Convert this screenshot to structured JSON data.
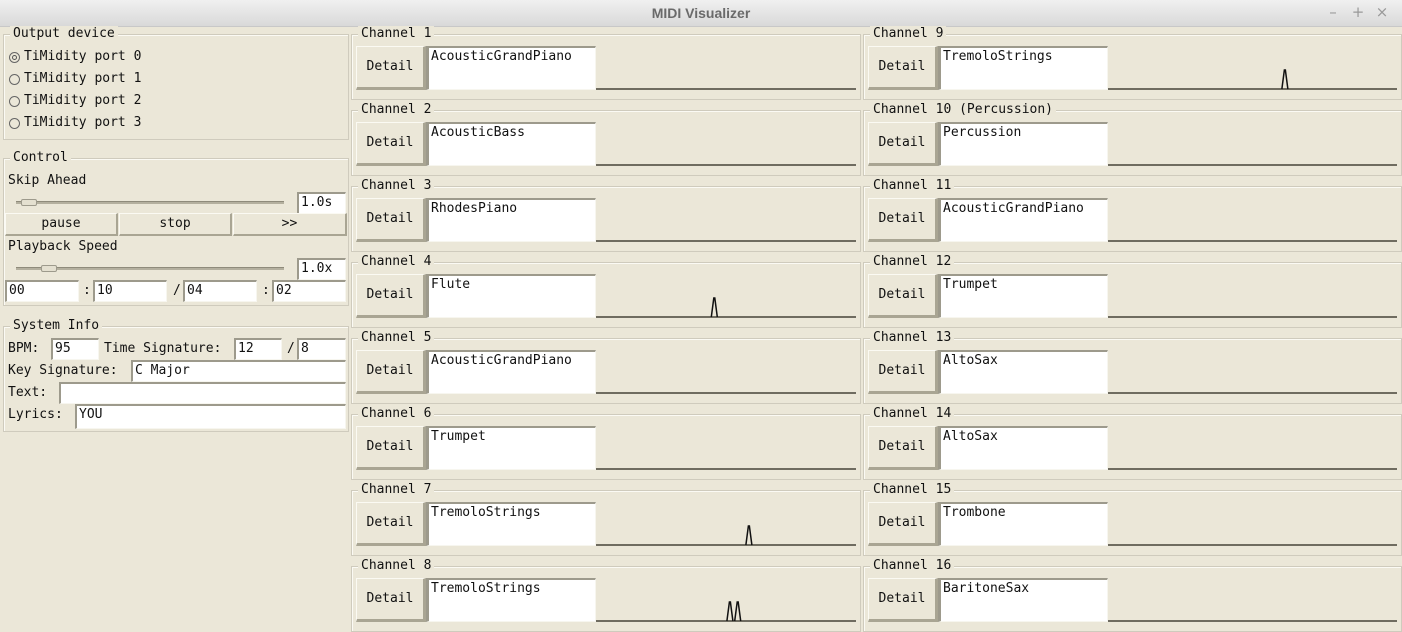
{
  "window": {
    "title": "MIDI Visualizer",
    "controls": {
      "minimize": "–",
      "maximize": "+",
      "close": "×"
    }
  },
  "output_device": {
    "label": "Output device",
    "selected_index": 0,
    "ports": [
      "TiMidity port 0",
      "TiMidity port 1",
      "TiMidity port 2",
      "TiMidity port 3"
    ]
  },
  "control": {
    "label": "Control",
    "skip_ahead": {
      "label": "Skip Ahead",
      "value": "1.0s",
      "slider_fraction": 0.02
    },
    "buttons": {
      "pause": "pause",
      "stop": "stop",
      "forward": ">>"
    },
    "playback_speed": {
      "label": "Playback Speed",
      "value": "1.0x",
      "slider_fraction": 0.1
    },
    "time": {
      "current_min": "00",
      "sep1": ":",
      "current_sec": "10",
      "slash": "/",
      "total_min": "04",
      "sep2": ":",
      "total_sec": "02"
    }
  },
  "system_info": {
    "label": "System Info",
    "bpm_label": "BPM:",
    "bpm": "95",
    "time_sig_label": "Time Signature:",
    "time_sig_num": "12",
    "time_sig_slash": "/",
    "time_sig_den": "8",
    "key_sig_label": "Key Signature:",
    "key_sig": "C Major",
    "text_label": "Text:",
    "text": "",
    "lyrics_label": "Lyrics:",
    "lyrics": "YOU"
  },
  "detail_label": "Detail",
  "channels": [
    {
      "label": "Channel 1",
      "instrument": "AcousticGrandPiano",
      "peaks": []
    },
    {
      "label": "Channel 2",
      "instrument": "AcousticBass",
      "peaks": []
    },
    {
      "label": "Channel 3",
      "instrument": "RhodesPiano",
      "peaks": []
    },
    {
      "label": "Channel 4",
      "instrument": "Flute",
      "peaks": [
        0.455
      ]
    },
    {
      "label": "Channel 5",
      "instrument": "AcousticGrandPiano",
      "peaks": []
    },
    {
      "label": "Channel 6",
      "instrument": "Trumpet",
      "peaks": []
    },
    {
      "label": "Channel 7",
      "instrument": "TremoloStrings",
      "peaks": [
        0.588
      ]
    },
    {
      "label": "Channel 8",
      "instrument": "TremoloStrings",
      "peaks": [
        0.515,
        0.545
      ]
    },
    {
      "label": "Channel 9",
      "instrument": "TremoloStrings",
      "peaks": [
        0.612
      ]
    },
    {
      "label": "Channel 10 (Percussion)",
      "instrument": "Percussion",
      "peaks": []
    },
    {
      "label": "Channel 11",
      "instrument": "AcousticGrandPiano",
      "peaks": []
    },
    {
      "label": "Channel 12",
      "instrument": "Trumpet",
      "peaks": []
    },
    {
      "label": "Channel 13",
      "instrument": "AltoSax",
      "peaks": []
    },
    {
      "label": "Channel 14",
      "instrument": "AltoSax",
      "peaks": []
    },
    {
      "label": "Channel 15",
      "instrument": "Trombone",
      "peaks": []
    },
    {
      "label": "Channel 16",
      "instrument": "BaritoneSax",
      "peaks": []
    }
  ],
  "colors": {
    "background": "#ebe7d8",
    "field": "#ffffff",
    "wave_baseline": "#6f6c60",
    "wave_peak": "#111111",
    "title_text": "#6a6a6a"
  }
}
